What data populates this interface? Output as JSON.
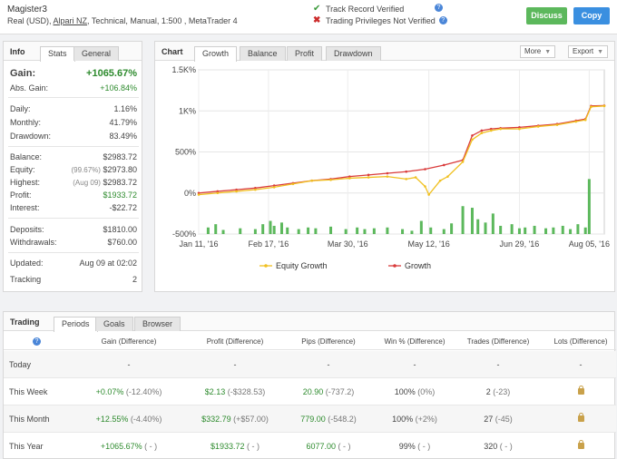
{
  "header": {
    "account_name": "Magister3",
    "account_prefix": "Real (USD), ",
    "broker": "Alpari NZ",
    "account_suffix": ", Technical, Manual, 1:500 , MetaTrader 4",
    "track_record": "Track Record Verified",
    "trading_privileges": "Trading Privileges Not Verified",
    "discuss_label": "Discuss",
    "copy_label": "Copy"
  },
  "info": {
    "title": "Info",
    "tabs": [
      "Stats",
      "General"
    ],
    "gain_label": "Gain:",
    "gain_value": "+1065.67%",
    "abs_gain_label": "Abs. Gain:",
    "abs_gain_value": "+106.84%",
    "daily_label": "Daily:",
    "daily_value": "1.16%",
    "monthly_label": "Monthly:",
    "monthly_value": "41.79%",
    "drawdown_label": "Drawdown:",
    "drawdown_value": "83.49%",
    "balance_label": "Balance:",
    "balance_value": "$2983.72",
    "equity_label": "Equity:",
    "equity_pct": "(99.67%)",
    "equity_value": "$2973.80",
    "highest_label": "Highest:",
    "highest_date": "(Aug 09)",
    "highest_value": "$2983.72",
    "profit_label": "Profit:",
    "profit_value": "$1933.72",
    "interest_label": "Interest:",
    "interest_value": "-$22.72",
    "deposits_label": "Deposits:",
    "deposits_value": "$1810.00",
    "withdrawals_label": "Withdrawals:",
    "withdrawals_value": "$760.00",
    "updated_label": "Updated:",
    "updated_value": "Aug 09 at 02:02",
    "tracking_label": "Tracking",
    "tracking_value": "2"
  },
  "chart": {
    "title": "Chart",
    "tabs": [
      "Growth",
      "Balance",
      "Profit",
      "Drawdown"
    ],
    "more_label": "More",
    "export_label": "Export",
    "legend_equity": "Equity Growth",
    "legend_growth": "Growth",
    "colors": {
      "growth": "#d93b3b",
      "equity": "#f0c020",
      "bars": "#5cb85c"
    }
  },
  "chart_data": {
    "type": "line",
    "y_tick_labels": [
      "1.5K%",
      "1K%",
      "500%",
      "0%",
      "-500%"
    ],
    "y_ticks": [
      1500,
      1000,
      500,
      0,
      -500
    ],
    "ylim": [
      -500,
      1500
    ],
    "x_tick_labels": [
      "Jan 11, '16",
      "Feb 17, '16",
      "Mar 30, '16",
      "May 12, '16",
      "Jun 29, '16",
      "Aug 05, '16"
    ],
    "x_tick_index": [
      0,
      37,
      79,
      122,
      170,
      207
    ],
    "x_range": [
      0,
      215
    ],
    "series": [
      {
        "name": "Growth",
        "x": [
          0,
          10,
          20,
          30,
          40,
          50,
          60,
          70,
          80,
          90,
          100,
          110,
          120,
          130,
          140,
          145,
          150,
          155,
          160,
          170,
          180,
          190,
          200,
          205,
          208,
          215
        ],
        "y": [
          0,
          20,
          40,
          60,
          90,
          120,
          150,
          170,
          200,
          220,
          240,
          260,
          290,
          340,
          400,
          700,
          760,
          780,
          790,
          800,
          820,
          840,
          880,
          900,
          1060,
          1065
        ]
      },
      {
        "name": "Equity Growth",
        "x": [
          0,
          10,
          20,
          30,
          40,
          50,
          60,
          70,
          80,
          90,
          100,
          110,
          115,
          120,
          122,
          128,
          132,
          140,
          145,
          150,
          155,
          160,
          170,
          180,
          190,
          200,
          205,
          208,
          215
        ],
        "y": [
          -20,
          0,
          20,
          40,
          70,
          110,
          150,
          160,
          180,
          190,
          200,
          170,
          190,
          80,
          -20,
          150,
          200,
          380,
          650,
          730,
          760,
          780,
          780,
          810,
          830,
          870,
          890,
          1050,
          1060
        ]
      }
    ],
    "bars": {
      "x": [
        5,
        9,
        13,
        22,
        30,
        34,
        38,
        40,
        44,
        47,
        53,
        58,
        62,
        70,
        78,
        84,
        88,
        93,
        100,
        108,
        113,
        118,
        123,
        130,
        134,
        140,
        145,
        148,
        152,
        156,
        160,
        166,
        170,
        173,
        178,
        184,
        188,
        193,
        197,
        201,
        205,
        207
      ],
      "h": [
        -420,
        -380,
        -450,
        -430,
        -440,
        -380,
        -340,
        -400,
        -360,
        -420,
        -440,
        -420,
        -430,
        -410,
        -440,
        -420,
        -440,
        -430,
        -420,
        -440,
        -460,
        -340,
        -420,
        -440,
        -370,
        -160,
        -180,
        -320,
        -360,
        -250,
        -400,
        -380,
        -430,
        -420,
        -400,
        -430,
        -420,
        -400,
        -440,
        -380,
        -420,
        170
      ]
    }
  },
  "trading": {
    "title": "Trading",
    "tabs": [
      "Periods",
      "Goals",
      "Browser"
    ],
    "columns": [
      "Gain (Difference)",
      "Profit (Difference)",
      "Pips (Difference)",
      "Win % (Difference)",
      "Trades (Difference)",
      "Lots (Difference)"
    ],
    "rows": [
      {
        "label": "Today",
        "gain": "-",
        "gain_diff": "",
        "profit": "-",
        "profit_diff": "",
        "pips": "-",
        "pips_diff": "",
        "win": "-",
        "win_diff": "",
        "trades": "-",
        "trades_diff": "",
        "lots": "-"
      },
      {
        "label": "This Week",
        "gain": "+0.07%",
        "gain_diff": "(-12.40%)",
        "profit": "$2.13",
        "profit_diff": "(-$328.53)",
        "pips": "20.90",
        "pips_diff": "(-737.2)",
        "win": "100%",
        "win_diff": "(0%)",
        "trades": "2",
        "trades_diff": "(-23)",
        "lots": "lock"
      },
      {
        "label": "This Month",
        "gain": "+12.55%",
        "gain_diff": "(-4.40%)",
        "profit": "$332.79",
        "profit_diff": "(+$57.00)",
        "pips": "779.00",
        "pips_diff": "(-548.2)",
        "win": "100%",
        "win_diff": "(+2%)",
        "trades": "27",
        "trades_diff": "(-45)",
        "lots": "lock"
      },
      {
        "label": "This Year",
        "gain": "+1065.67%",
        "gain_diff": "( - )",
        "profit": "$1933.72",
        "profit_diff": "( - )",
        "pips": "6077.00",
        "pips_diff": "( - )",
        "win": "99%",
        "win_diff": "( - )",
        "trades": "320",
        "trades_diff": "( - )",
        "lots": "lock"
      }
    ]
  }
}
